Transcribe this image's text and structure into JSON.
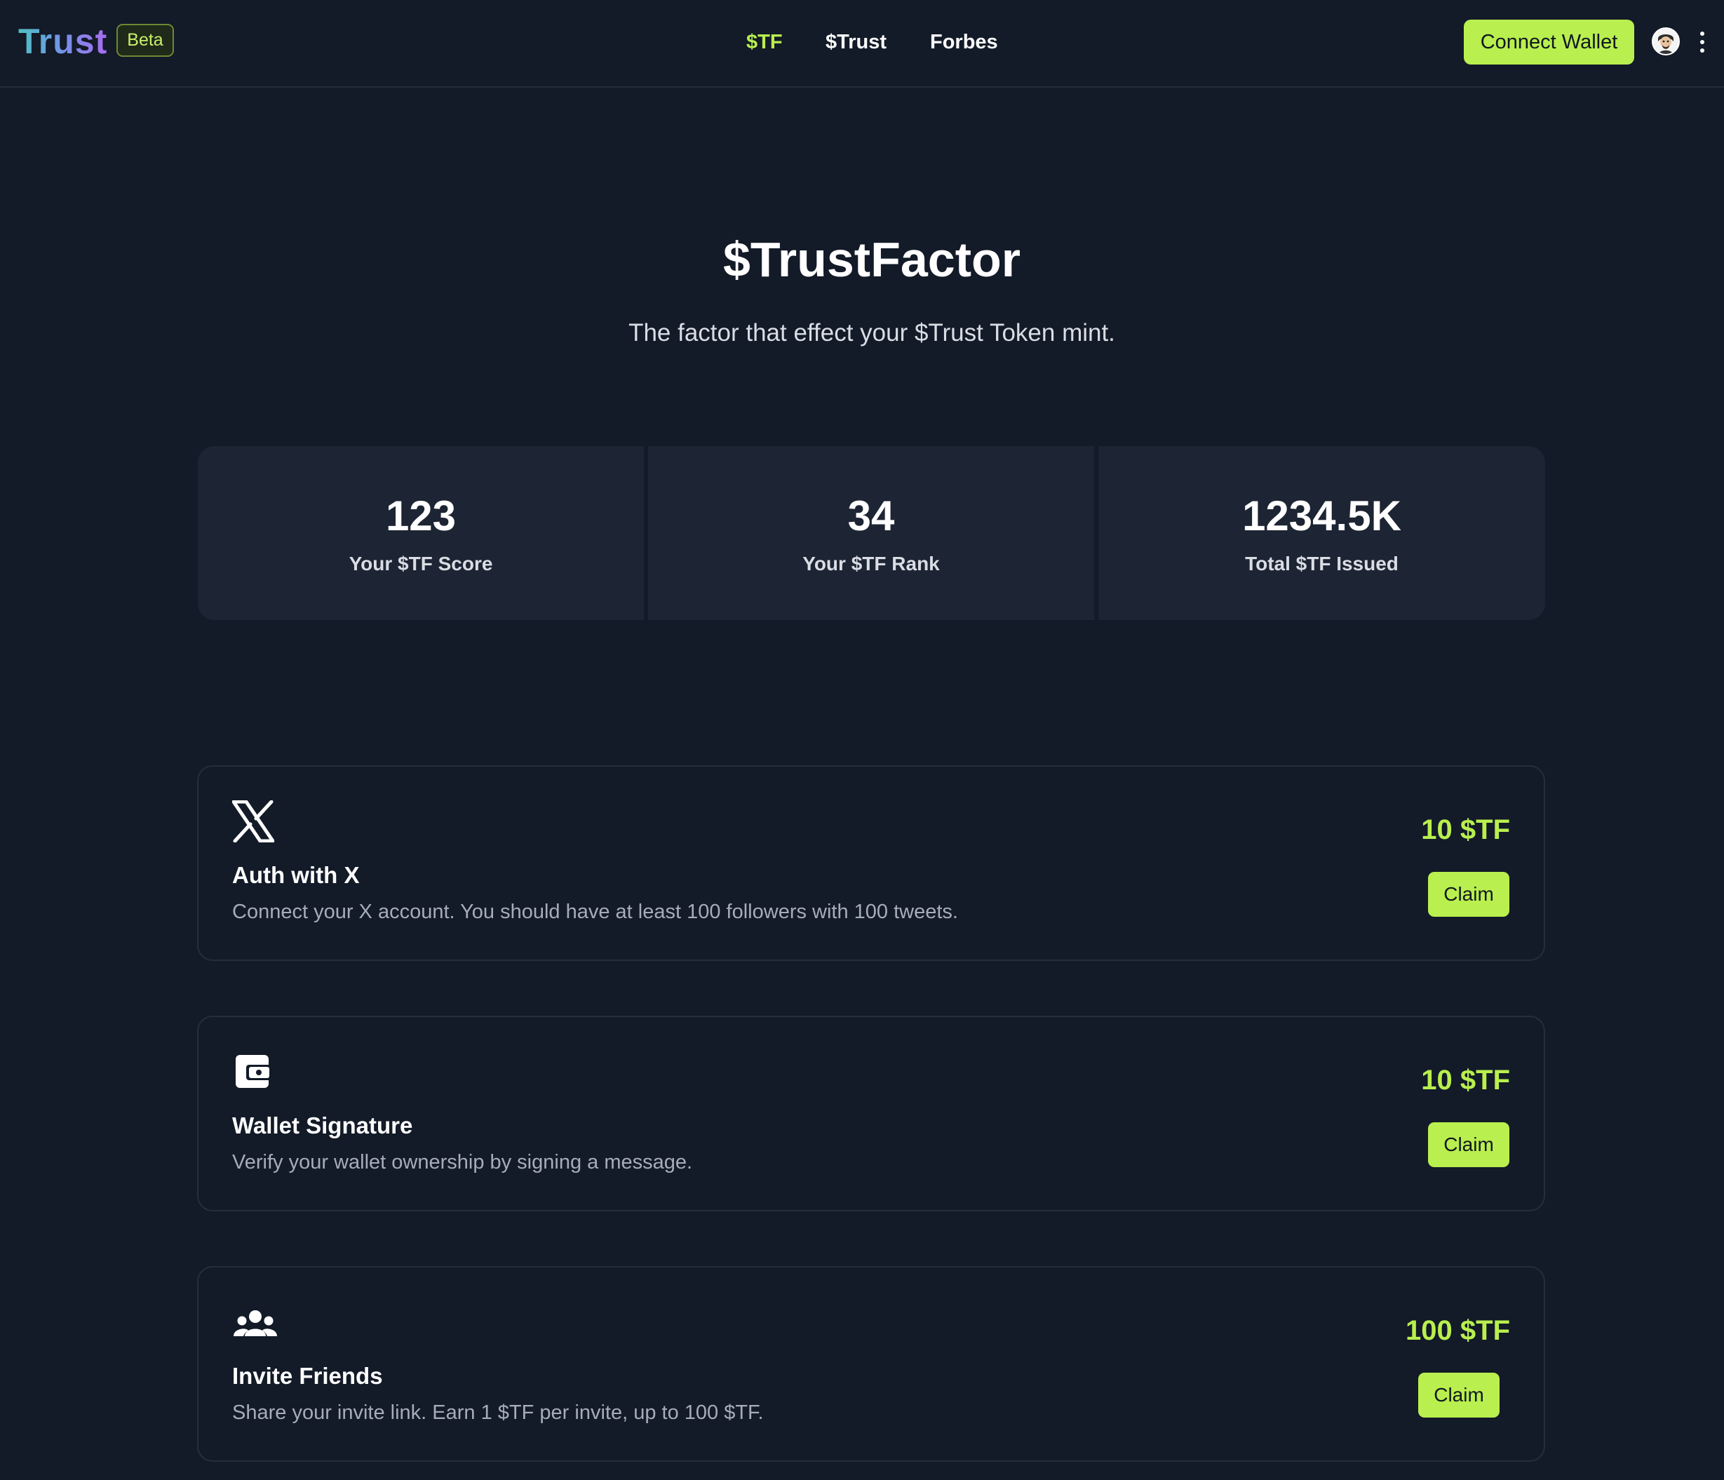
{
  "brand": {
    "name": "Trust",
    "badge": "Beta"
  },
  "nav": {
    "items": [
      {
        "label": "$TF",
        "active": true
      },
      {
        "label": "$Trust",
        "active": false
      },
      {
        "label": "Forbes",
        "active": false
      }
    ],
    "connect_label": "Connect Wallet",
    "avatar_icon": "user-avatar-icon",
    "menu_icon": "kebab-menu-icon"
  },
  "hero": {
    "title": "$TrustFactor",
    "subtitle": "The factor that effect your $Trust Token mint."
  },
  "stats": [
    {
      "value": "123",
      "label": "Your $TF Score"
    },
    {
      "value": "34",
      "label": "Your $TF Rank"
    },
    {
      "value": "1234.5K",
      "label": "Total $TF Issued"
    }
  ],
  "tasks": [
    {
      "icon": "x-logo-icon",
      "title": "Auth with X",
      "description": "Connect your X account. You should have at least 100 followers with 100 tweets.",
      "reward": "10 $TF",
      "button": "Claim"
    },
    {
      "icon": "wallet-icon",
      "title": "Wallet Signature",
      "description": "Verify your wallet ownership by signing a message.",
      "reward": "10 $TF",
      "button": "Claim"
    },
    {
      "icon": "users-icon",
      "title": "Invite Friends",
      "description": "Share your invite link. Earn 1 $TF per invite, up to 100 $TF.",
      "reward": "100 $TF",
      "button": "Claim"
    }
  ],
  "colors": {
    "background": "#131a28",
    "accent": "#b9ef4e",
    "card": "#1d2433",
    "muted_text": "#a7adb8"
  }
}
